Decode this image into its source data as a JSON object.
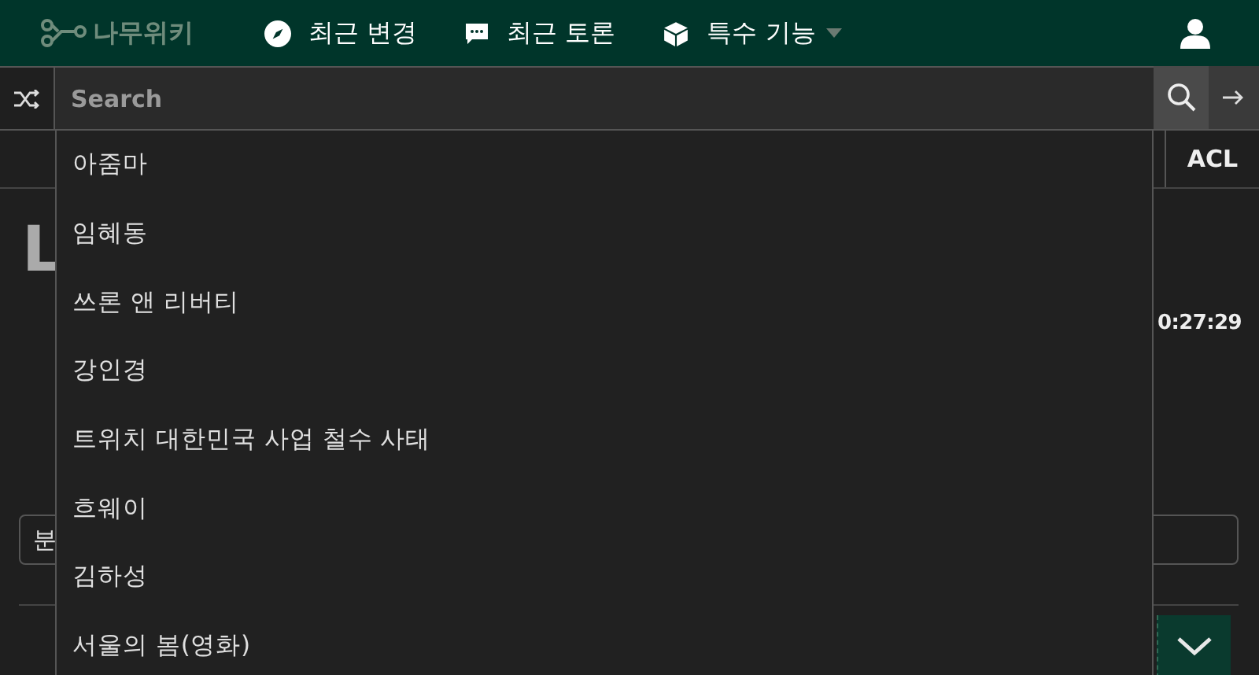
{
  "nav": {
    "logo": "나무위키",
    "items": [
      {
        "label": "최근 변경",
        "kind": "compass",
        "dropdown": false
      },
      {
        "label": "최근 토론",
        "kind": "chat",
        "dropdown": false
      },
      {
        "label": "특수 기능",
        "kind": "cube",
        "dropdown": true
      }
    ]
  },
  "search": {
    "placeholder": "Search"
  },
  "suggestions": [
    "아줌마",
    "임혜동",
    "쓰론 앤 리버티",
    "강인경",
    "트위치 대한민국 사업 철수 사태",
    "흐웨이",
    "김하성",
    "서울의 봄(영화)"
  ],
  "page": {
    "acl_button": "ACL",
    "title_fragment": "L",
    "time_fragment": "0:27:29",
    "field_fragment": "분"
  }
}
